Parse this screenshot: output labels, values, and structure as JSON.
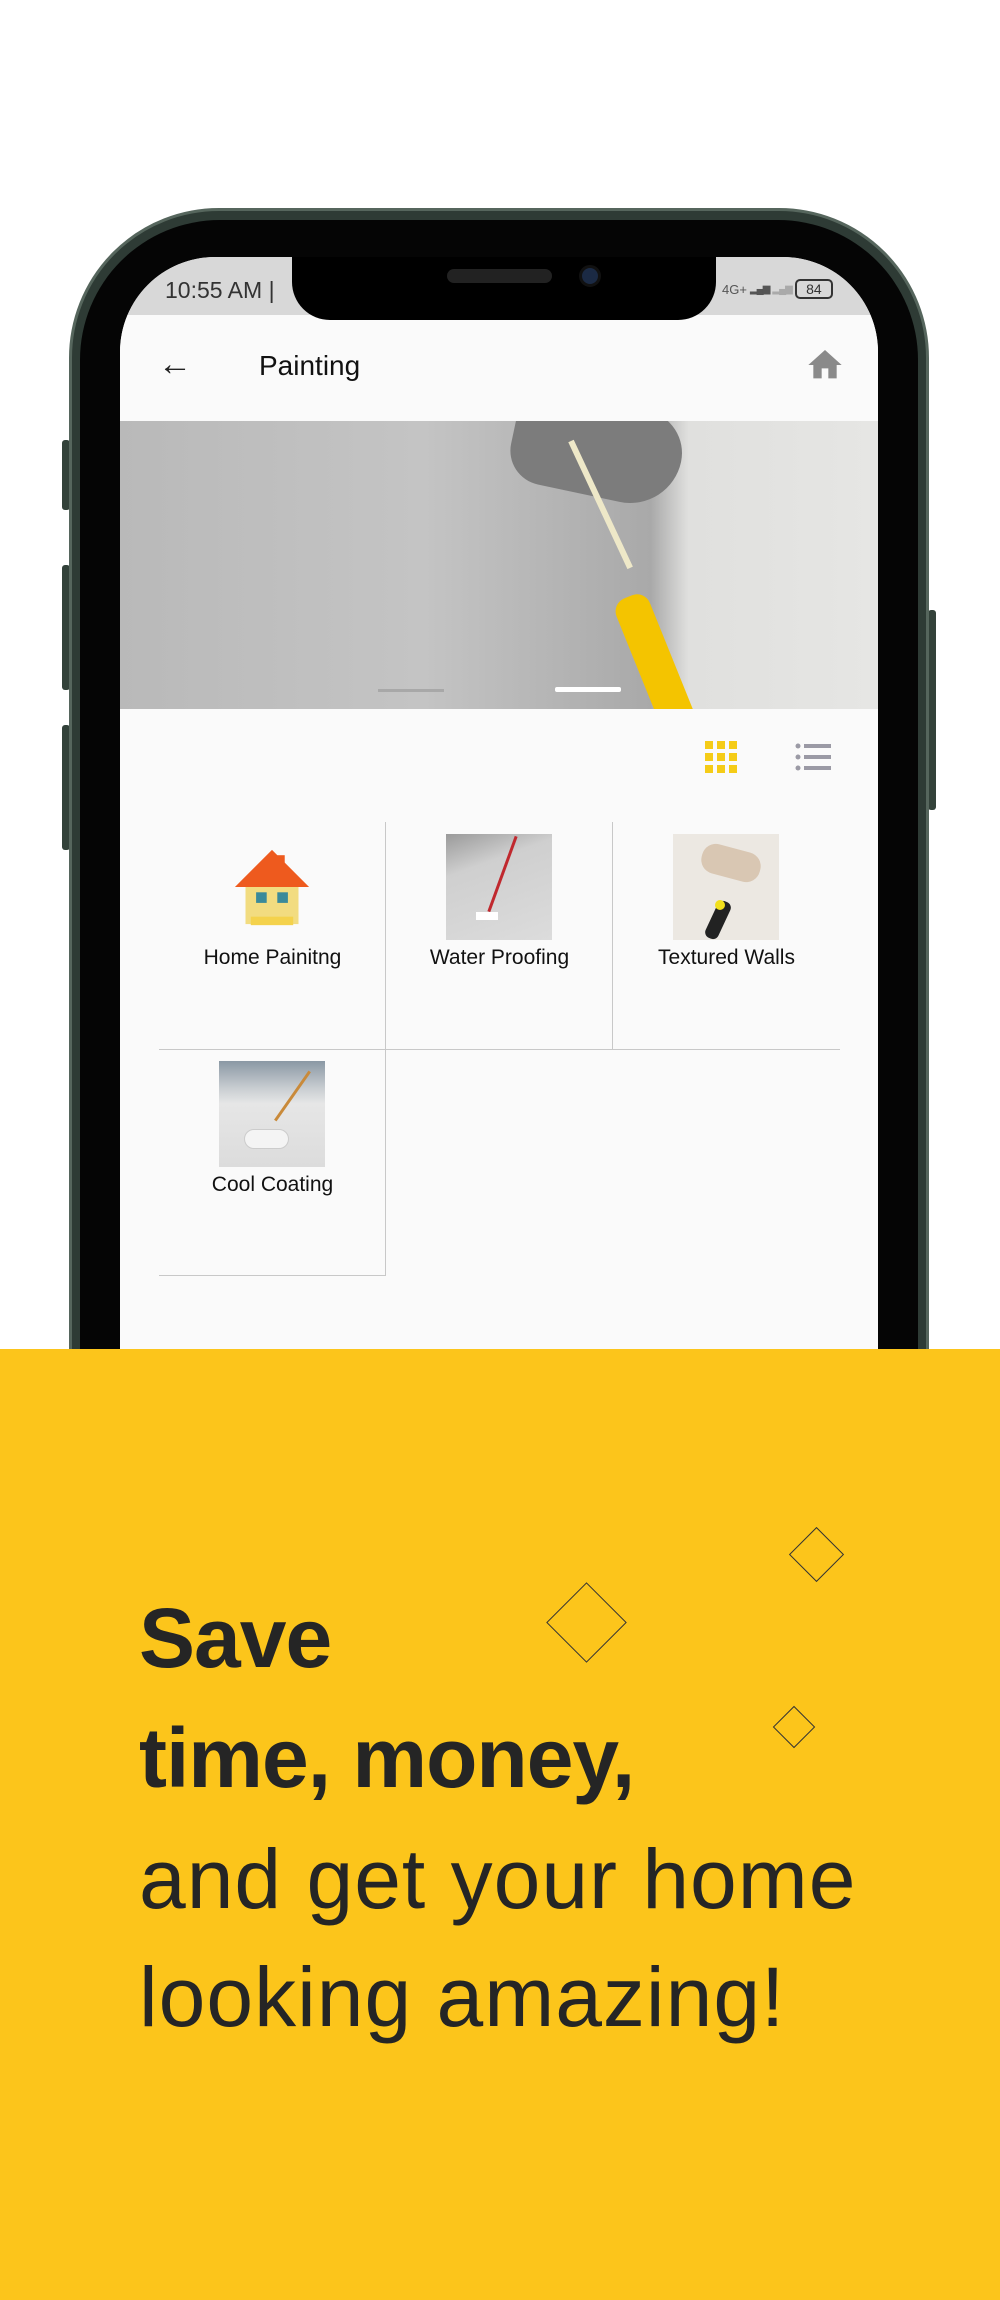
{
  "status_bar": {
    "time": "10:55 AM |",
    "network": "4G+",
    "battery": "84"
  },
  "app_bar": {
    "title": "Painting",
    "back_icon": "arrow-left-icon",
    "home_icon": "home-icon"
  },
  "banner": {
    "image": "paint-roller-on-wall",
    "slides": 2,
    "active_slide": 2
  },
  "view_toggle": {
    "active": "grid",
    "active_color": "#f5cc17",
    "inactive_color": "#9b9aa5"
  },
  "services": [
    {
      "label": "Home Painitng",
      "image": "house-illustration"
    },
    {
      "label": "Water Proofing",
      "image": "floor-coating-photo"
    },
    {
      "label": "Textured Walls",
      "image": "texture-roller-photo"
    },
    {
      "label": "Cool Coating",
      "image": "roof-roller-photo"
    }
  ],
  "promo": {
    "line1": "Save",
    "line2": "time, money,",
    "line3": "and get your home",
    "line4": "looking amazing!",
    "background": "#fcc51b"
  }
}
